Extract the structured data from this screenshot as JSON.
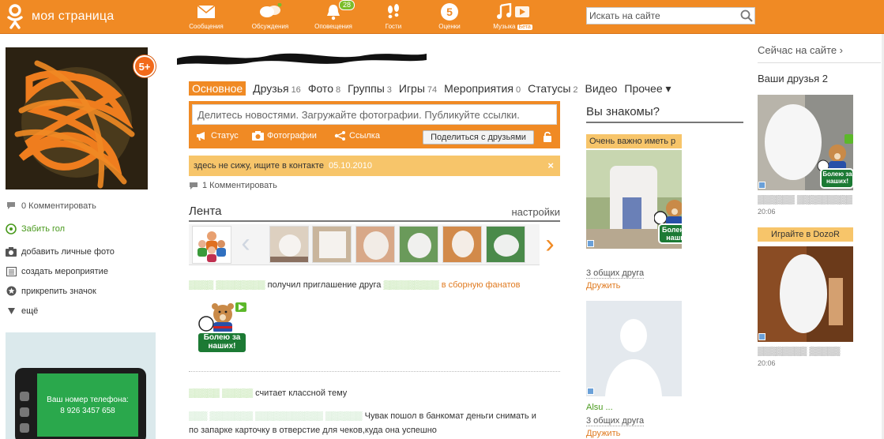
{
  "brand": {
    "title": "моя страница",
    "accent": "#f08a24"
  },
  "nav": [
    {
      "label": "Сообщения",
      "icon": "envelope-icon"
    },
    {
      "label": "Обсуждения",
      "icon": "discussions-icon"
    },
    {
      "label": "Оповещения",
      "icon": "bell-icon",
      "badge": "28"
    },
    {
      "label": "Гости",
      "icon": "footprints-icon"
    },
    {
      "label": "Оценки",
      "icon": "rating-icon",
      "badge": "5"
    },
    {
      "label": "Музыка",
      "icon": "music-icon",
      "tag": "Бета"
    }
  ],
  "search": {
    "placeholder": "Искать на сайте"
  },
  "profile": {
    "badge": "5+"
  },
  "left": {
    "comment": "0 Комментировать",
    "links": [
      {
        "label": "Забить гол",
        "icon": "football-icon"
      },
      {
        "label": "добавить личные фото",
        "icon": "camera-icon"
      },
      {
        "label": "создать мероприятие",
        "icon": "calendar-icon"
      },
      {
        "label": "прикрепить значок",
        "icon": "star-icon"
      },
      {
        "label": "ещё",
        "icon": "triangle-down-icon"
      }
    ],
    "ad": {
      "line1": "Ваш номер телефона:",
      "line2": "8 926 3457 658"
    }
  },
  "tabs": [
    {
      "label": "Основное",
      "count": "",
      "active": true
    },
    {
      "label": "Друзья",
      "count": "16"
    },
    {
      "label": "Фото",
      "count": "8"
    },
    {
      "label": "Группы",
      "count": "3"
    },
    {
      "label": "Игры",
      "count": "74"
    },
    {
      "label": "Мероприятия",
      "count": "0"
    },
    {
      "label": "Статусы",
      "count": "2"
    },
    {
      "label": "Видео",
      "count": ""
    },
    {
      "label": "Прочее ▾",
      "count": ""
    }
  ],
  "share": {
    "placeholder": "Делитесь новостями. Загружайте фотографии. Публикуйте ссылки.",
    "status": "Статус",
    "photos": "Фотографии",
    "link": "Ссылка",
    "button": "Поделиться с друзьями"
  },
  "status": {
    "text": "здесь не сижу, ищите в контакте",
    "date": "05.10.2010",
    "close": "×"
  },
  "status_comment": "1 Комментировать",
  "feed": {
    "title": "Лента",
    "settings": "настройки",
    "item1_action": "получил приглашение друга",
    "item1_target": "в сборную фанатов",
    "sticker_text": "Болею за наших!",
    "item2_action": "считает классной тему",
    "item3_text": "Чувак пошол в банкомат деньги снимать и по запарке карточку в отверстие для чеков,куда она успешно"
  },
  "suggest": {
    "title": "Вы знакомы?",
    "label": "Очень важно иметь р",
    "mutual1": "3 общих друга",
    "add1": "Дружить",
    "name2": "Alsu ...",
    "mutual2": "3 общих друга",
    "add2": "Дружить"
  },
  "right": {
    "online": "Сейчас на сайте ›",
    "friends": "Ваши друзья 2",
    "time1": "20:06",
    "game": "Играйте в DozoR",
    "time2": "20:06"
  }
}
